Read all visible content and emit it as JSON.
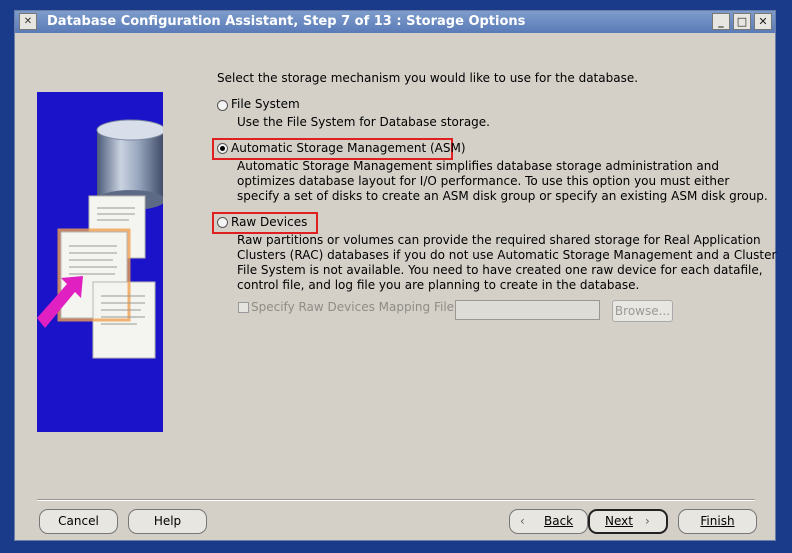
{
  "window": {
    "title": "Database Configuration Assistant, Step 7 of 13 : Storage Options",
    "system_button": "✕",
    "minimize": "_",
    "maximize": "□",
    "close": "✕"
  },
  "main": {
    "instruction": "Select the storage mechanism you would like to use for the database.",
    "options": [
      {
        "label": "File System",
        "selected": false,
        "description": [
          "Use the File System for Database storage."
        ]
      },
      {
        "label": "Automatic Storage Management (ASM)",
        "selected": true,
        "description": [
          "Automatic Storage Management simplifies database storage administration and",
          "optimizes database layout for I/O performance. To use this option you must either",
          "specify a set of disks to create an ASM disk group or specify an existing ASM disk group."
        ]
      },
      {
        "label": "Raw Devices",
        "selected": false,
        "description": [
          "Raw partitions or volumes can provide the required shared storage for Real Application",
          "Clusters (RAC) databases if you do not use Automatic Storage Management and a Cluster",
          "File System is not available.  You need to have created one raw device for each datafile,",
          "control file, and log file you are planning to create in the database."
        ]
      }
    ],
    "raw_mapping": {
      "checkbox_label": "Specify Raw Devices Mapping File",
      "checked": false,
      "value": "",
      "browse": "Browse..."
    }
  },
  "footer": {
    "cancel": "Cancel",
    "help": "Help",
    "back": "Back",
    "next": "Next",
    "finish": "Finish"
  }
}
